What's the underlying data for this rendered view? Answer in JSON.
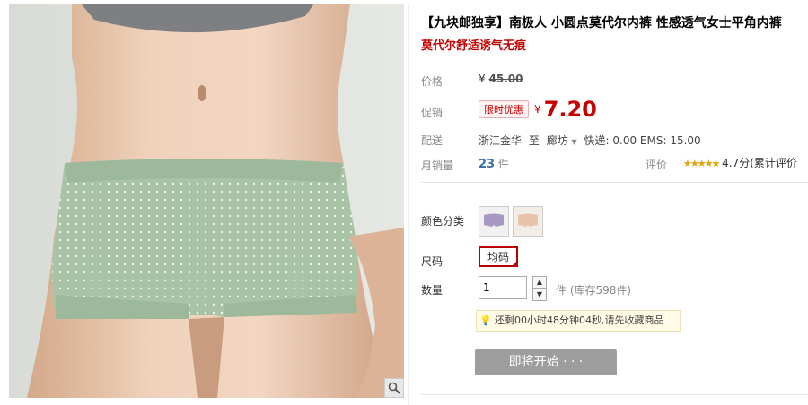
{
  "product": {
    "title_line1": "【九块邮独享】南极人 小圆点莫代尔内裤 性感透气女士平角内裤",
    "title_line2": "莫代尔舒适诱气无痕"
  },
  "price": {
    "label": "价格",
    "currency": "¥",
    "original": "45.00"
  },
  "promo": {
    "label": "促销",
    "badge": "限时优惠",
    "currency": "¥",
    "price": "7.20"
  },
  "shipping": {
    "label": "配送",
    "from": "浙江金华",
    "to_word": "至",
    "to": "廊坊",
    "fee": "快递: 0.00 EMS: 15.00"
  },
  "sales": {
    "label": "月销量",
    "count": "23",
    "unit": "件"
  },
  "rating": {
    "label": "评价",
    "stars": "★★★★★",
    "text": "4.7分(累计评价"
  },
  "color": {
    "label": "颜色分类"
  },
  "size": {
    "label": "尺码",
    "option": "均码"
  },
  "quantity": {
    "label": "数量",
    "value": "1",
    "stock": "件 (库存598件)"
  },
  "tip": {
    "text": "还剩00小时48分钟04秒,请先收藏商品"
  },
  "button": {
    "label": "即将开始 · · ·"
  },
  "colors": {
    "accent": "#c40000",
    "sales_blue": "#3a6ea5",
    "star": "#e2a400",
    "button_gray": "#9e9e9e"
  }
}
